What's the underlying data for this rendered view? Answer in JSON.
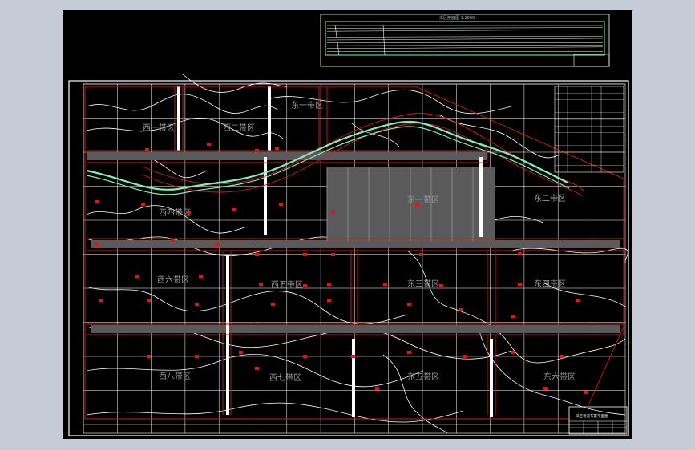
{
  "window": {
    "background": "#c5ccd6",
    "viewport_bg": "#000000"
  },
  "colors": {
    "grid": "#ffffff",
    "contour": "#ffffff",
    "boundary": "#e0161b",
    "river": "#7ef0c0",
    "roadway": "#5a5a5a",
    "marker": "#e0161b",
    "label": "#9a9a9a"
  },
  "zones": [
    {
      "id": "west-2",
      "label": "西二带区"
    },
    {
      "id": "east-1-top",
      "label": "东一带区"
    },
    {
      "id": "west-1",
      "label": "西一带区"
    },
    {
      "id": "east-1",
      "label": "东一带区"
    },
    {
      "id": "west-4",
      "label": "西四带区"
    },
    {
      "id": "east-2",
      "label": "东二带区"
    },
    {
      "id": "west-6",
      "label": "西六带区"
    },
    {
      "id": "west-5",
      "label": "西五带区"
    },
    {
      "id": "east-3",
      "label": "东三带区"
    },
    {
      "id": "east-4",
      "label": "东四带区"
    },
    {
      "id": "west-8",
      "label": "西八带区"
    },
    {
      "id": "west-7",
      "label": "西七带区"
    },
    {
      "id": "east-5",
      "label": "东五带区"
    },
    {
      "id": "east-6",
      "label": "东六带区"
    }
  ],
  "section_box": {
    "title": "采区剖面图 1:2000"
  },
  "legend": {
    "rows": 13
  },
  "title_block": {
    "name": "采区巷道布置平面图"
  }
}
